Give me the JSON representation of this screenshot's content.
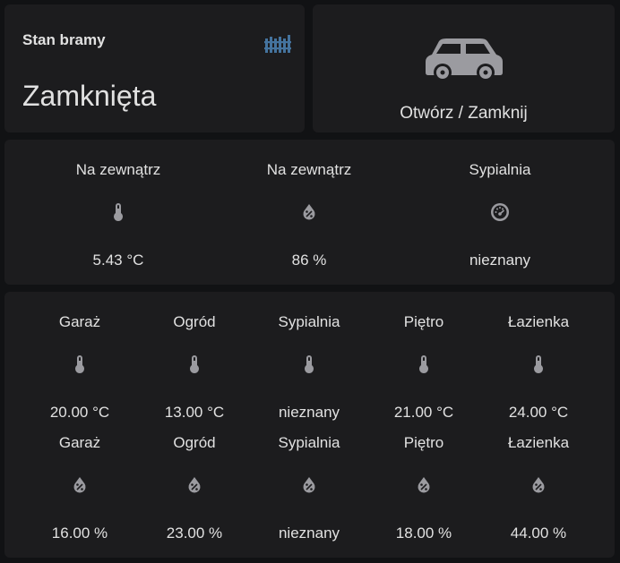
{
  "gate": {
    "title": "Stan bramy",
    "state": "Zamknięta",
    "icon": "fence-icon",
    "icon_color": "#44739e"
  },
  "toggle": {
    "label": "Otwórz / Zamknij",
    "icon": "car-icon",
    "icon_color": "#9b9ba0"
  },
  "glance_top": [
    {
      "name": "Na zewnątrz",
      "icon": "thermometer-icon",
      "state": "5.43 °C"
    },
    {
      "name": "Na zewnątrz",
      "icon": "water-percent-icon",
      "state": "86 %"
    },
    {
      "name": "Sypialnia",
      "icon": "gauge-icon",
      "state": "nieznany"
    }
  ],
  "glance_temp": [
    {
      "name": "Garaż",
      "icon": "thermometer-icon",
      "state": "20.00 °C"
    },
    {
      "name": "Ogród",
      "icon": "thermometer-icon",
      "state": "13.00 °C"
    },
    {
      "name": "Sypialnia",
      "icon": "thermometer-icon",
      "state": "nieznany"
    },
    {
      "name": "Piętro",
      "icon": "thermometer-icon",
      "state": "21.00 °C"
    },
    {
      "name": "Łazienka",
      "icon": "thermometer-icon",
      "state": "24.00 °C"
    }
  ],
  "glance_hum": [
    {
      "name": "Garaż",
      "icon": "water-percent-icon",
      "state": "16.00 %"
    },
    {
      "name": "Ogród",
      "icon": "water-percent-icon",
      "state": "23.00 %"
    },
    {
      "name": "Sypialnia",
      "icon": "water-percent-icon",
      "state": "nieznany"
    },
    {
      "name": "Piętro",
      "icon": "water-percent-icon",
      "state": "18.00 %"
    },
    {
      "name": "Łazienka",
      "icon": "water-percent-icon",
      "state": "44.00 %"
    }
  ],
  "colors": {
    "background": "#111214",
    "card": "#1c1c1e",
    "text": "#e1e1e1",
    "icon": "#9b9ba0",
    "accent": "#44739e"
  }
}
